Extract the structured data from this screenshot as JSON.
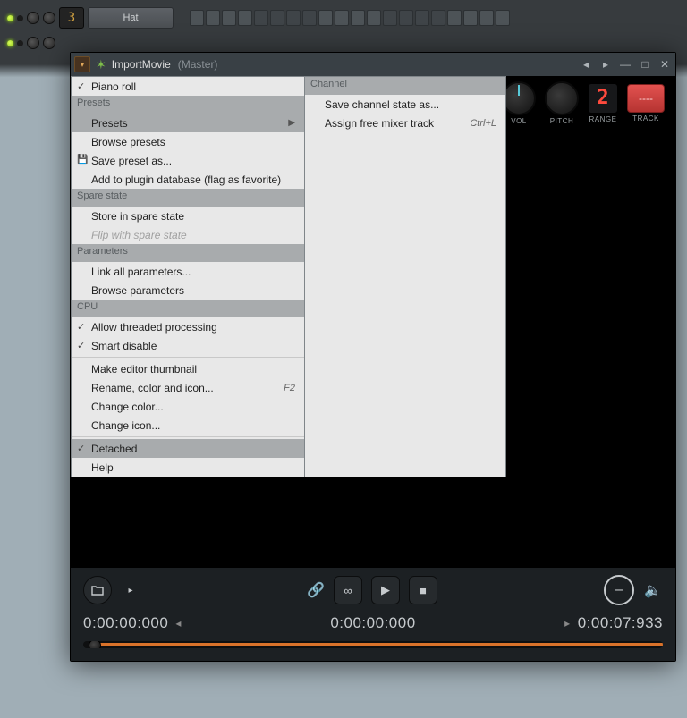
{
  "pattern": {
    "rows": [
      {
        "num": "3",
        "name": "Hat"
      }
    ]
  },
  "window": {
    "title": "ImportMovie",
    "subtitle": "(Master)",
    "header": {
      "vol_label": "VOL",
      "pitch_label": "PITCH",
      "range_label": "RANGE",
      "track_label": "TRACK",
      "range_value": "2",
      "track_pattern": "----"
    }
  },
  "menu_left": [
    {
      "type": "item",
      "label": "Piano roll",
      "checked": true
    },
    {
      "type": "section",
      "label": "Presets"
    },
    {
      "type": "item",
      "label": "Presets",
      "submenu": true,
      "active": true
    },
    {
      "type": "item",
      "label": "Browse presets"
    },
    {
      "type": "item",
      "label": "Save preset as...",
      "icon": "save"
    },
    {
      "type": "item",
      "label": "Add to plugin database (flag as favorite)"
    },
    {
      "type": "section",
      "label": "Spare state"
    },
    {
      "type": "item",
      "label": "Store in spare state"
    },
    {
      "type": "item",
      "label": "Flip with spare state",
      "disabled": true
    },
    {
      "type": "section",
      "label": "Parameters"
    },
    {
      "type": "item",
      "label": "Link all parameters..."
    },
    {
      "type": "item",
      "label": "Browse parameters"
    },
    {
      "type": "section",
      "label": "CPU"
    },
    {
      "type": "item",
      "label": "Allow threaded processing",
      "checked": true
    },
    {
      "type": "item",
      "label": "Smart disable",
      "checked": true
    },
    {
      "type": "sep"
    },
    {
      "type": "item",
      "label": "Make editor thumbnail"
    },
    {
      "type": "item",
      "label": "Rename, color and icon...",
      "hotkey": "F2"
    },
    {
      "type": "item",
      "label": "Change color..."
    },
    {
      "type": "item",
      "label": "Change icon..."
    },
    {
      "type": "sep"
    },
    {
      "type": "item",
      "label": "Detached",
      "checked": true,
      "active": true
    },
    {
      "type": "item",
      "label": "Help"
    }
  ],
  "menu_right": [
    {
      "type": "section",
      "label": "Channel"
    },
    {
      "type": "item",
      "label": "Save channel state as..."
    },
    {
      "type": "item",
      "label": "Assign free mixer track",
      "hotkey": "Ctrl+L"
    }
  ],
  "transport": {
    "tc_start": "0:00:00:000",
    "tc_pos": "0:00:00:000",
    "tc_end": "0:00:07:933"
  }
}
